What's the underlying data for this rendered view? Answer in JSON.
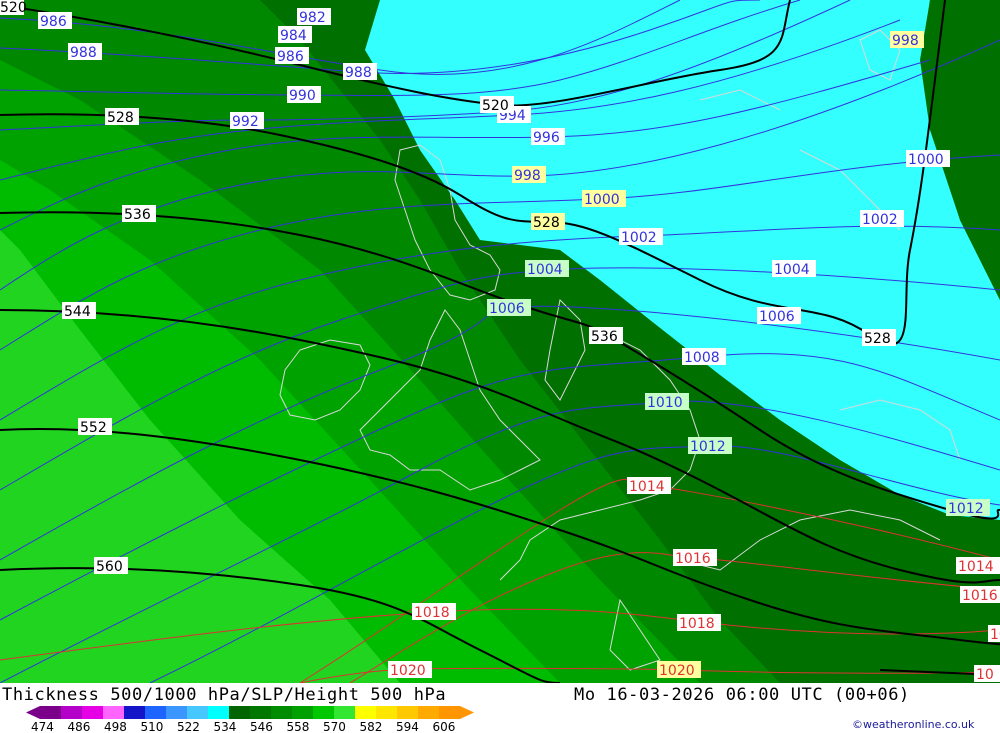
{
  "header": {
    "title": "Thickness 500/1000 hPa/SLP/Height 500 hPa",
    "datetime": "Mo 16-03-2026 06:00 UTC (00+06)",
    "credit": "©weatheronline.co.uk"
  },
  "legend": {
    "values": [
      "474",
      "486",
      "498",
      "510",
      "522",
      "534",
      "546",
      "558",
      "570",
      "582",
      "594",
      "606"
    ],
    "colors": [
      "#7a008a",
      "#b400c8",
      "#e600e6",
      "#ff64ff",
      "#1414c8",
      "#1e64ff",
      "#3c96ff",
      "#46c8ff",
      "#00ffff",
      "#006400",
      "#007800",
      "#008c00",
      "#00a000",
      "#00c800",
      "#32e632",
      "#ffff00",
      "#ffe600",
      "#ffc800",
      "#ffaa00",
      "#ff9600"
    ]
  },
  "colors": {
    "band_528": "#33ffff",
    "band_534": "#007000",
    "band_540": "#008800",
    "band_546": "#00a200",
    "band_552": "#00bc00",
    "band_558": "#20d420",
    "height_contour": "#000000",
    "slp_low": "#3333dd",
    "slp_high": "#dd3333",
    "coast": "#d8d8d8"
  },
  "height_labels": [
    {
      "text": "520"
    },
    {
      "text": "528"
    },
    {
      "text": "536"
    },
    {
      "text": "544"
    },
    {
      "text": "552"
    },
    {
      "text": "560"
    },
    {
      "text": "528"
    },
    {
      "text": "536"
    },
    {
      "text": "528"
    }
  ],
  "slp_labels": [
    {
      "text": "986"
    },
    {
      "text": "982"
    },
    {
      "text": "984"
    },
    {
      "text": "988"
    },
    {
      "text": "986"
    },
    {
      "text": "988"
    },
    {
      "text": "990"
    },
    {
      "text": "992"
    },
    {
      "text": "994"
    },
    {
      "text": "996"
    },
    {
      "text": "998"
    },
    {
      "text": "998"
    },
    {
      "text": "1000"
    },
    {
      "text": "1000"
    },
    {
      "text": "1002"
    },
    {
      "text": "1002"
    },
    {
      "text": "1004"
    },
    {
      "text": "1004"
    },
    {
      "text": "1006"
    },
    {
      "text": "1006"
    },
    {
      "text": "1008"
    },
    {
      "text": "1010"
    },
    {
      "text": "1012"
    },
    {
      "text": "1012"
    },
    {
      "text": "1014"
    },
    {
      "text": "1014"
    },
    {
      "text": "1016"
    },
    {
      "text": "1016"
    },
    {
      "text": "1018"
    },
    {
      "text": "1018"
    },
    {
      "text": "1020"
    },
    {
      "text": "1020"
    },
    {
      "text": "10"
    },
    {
      "text": "10"
    },
    {
      "text": "520"
    }
  ]
}
